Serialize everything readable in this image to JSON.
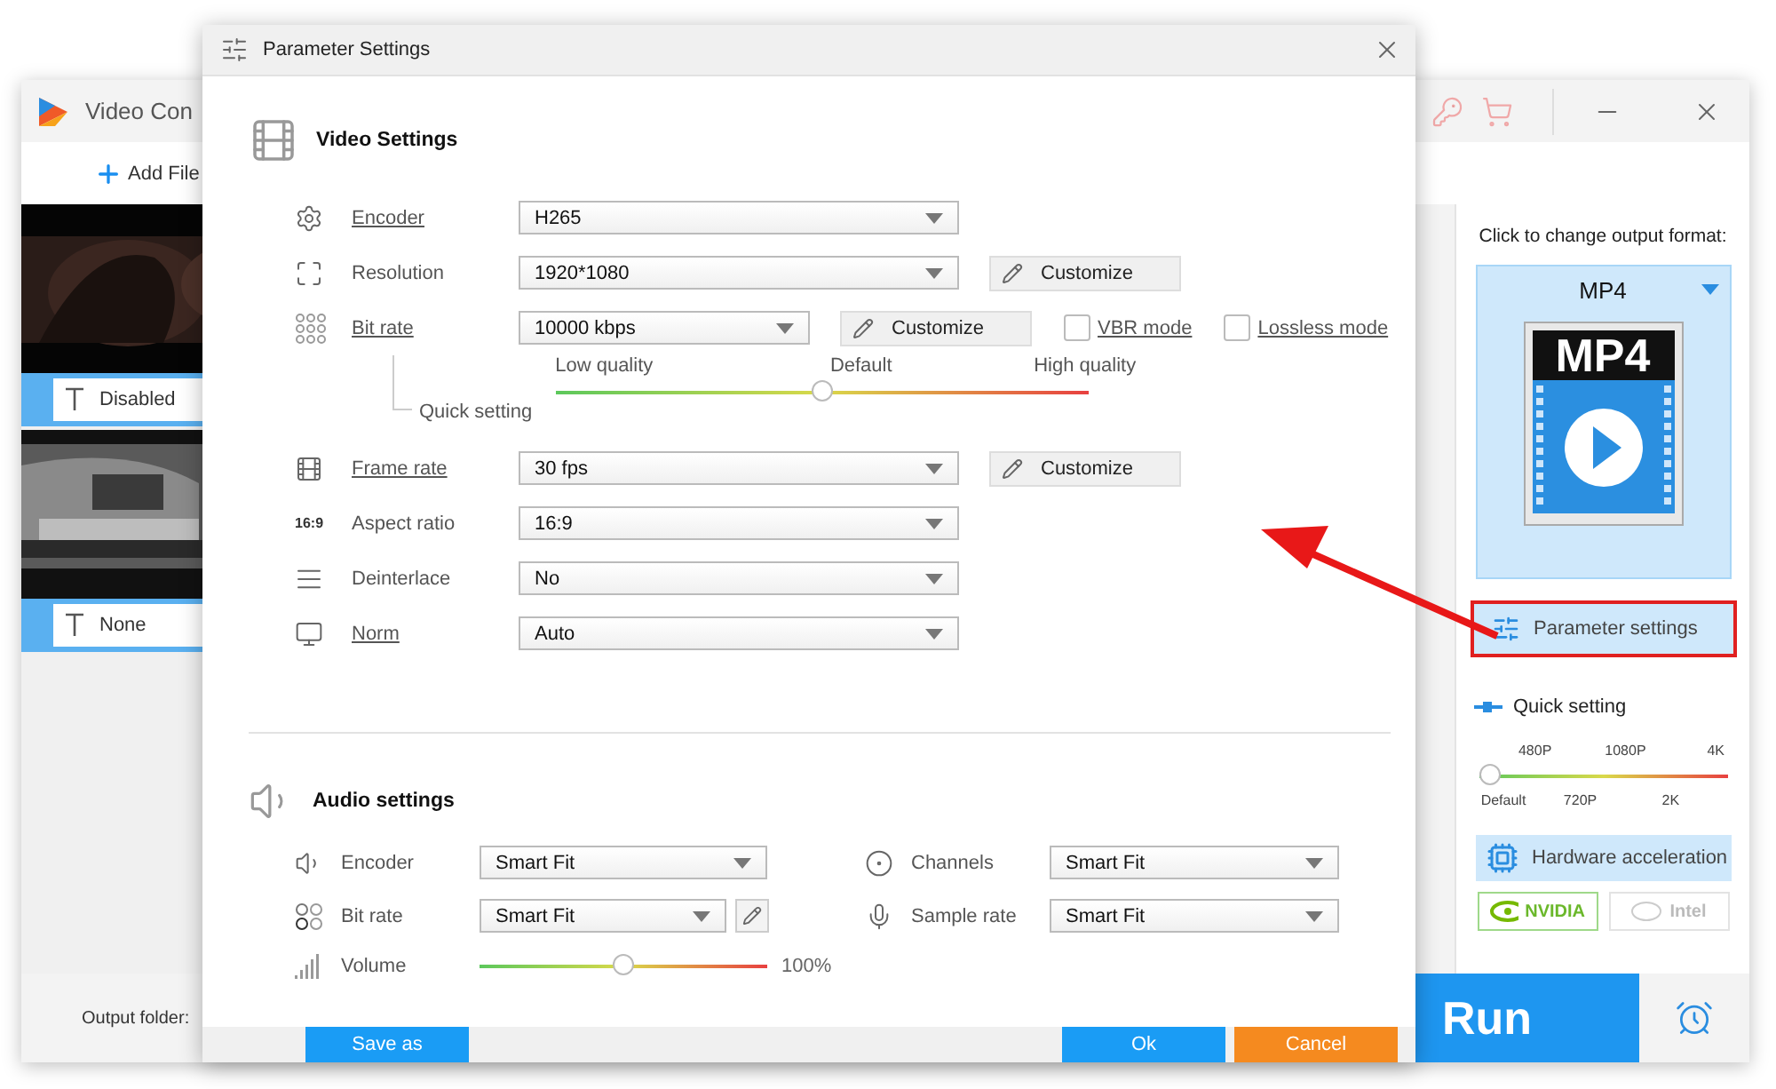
{
  "app": {
    "title": "Video Con",
    "add_file": "Add File",
    "files": [
      {
        "subtitle": "Disabled"
      },
      {
        "subtitle": "None"
      }
    ],
    "output_folder_label": "Output folder:",
    "run": "Run"
  },
  "format_panel": {
    "prompt": "Click to change output format:",
    "format": "MP4",
    "icon_label": "MP4",
    "parameter_button": "Parameter settings",
    "quick_setting": {
      "title": "Quick setting",
      "level": 0,
      "top_labels": [
        "480P",
        "1080P",
        "4K"
      ],
      "bottom_labels": [
        "Default",
        "720P",
        "2K"
      ]
    },
    "hardware": {
      "title": "Hardware acceleration",
      "options": [
        {
          "label": "NVIDIA",
          "enabled": true
        },
        {
          "label": "Intel",
          "enabled": false
        }
      ]
    }
  },
  "dialog": {
    "title": "Parameter Settings",
    "video": {
      "heading": "Video Settings",
      "rows": [
        {
          "kind": "select",
          "label": "Encoder",
          "link": true,
          "value": "H265"
        },
        {
          "kind": "select",
          "label": "Resolution",
          "link": false,
          "value": "1920*1080",
          "button": "Customize"
        },
        {
          "kind": "bitrate",
          "label": "Bit rate",
          "link": true,
          "value": "10000 kbps",
          "button": "Customize",
          "checkboxes": [
            {
              "label": "VBR mode",
              "checked": false
            },
            {
              "label": "Lossless mode",
              "checked": false
            }
          ],
          "quick": {
            "label": "Quick setting",
            "low": "Low quality",
            "mid": "Default",
            "high": "High quality",
            "level": 0.5
          }
        },
        {
          "kind": "select",
          "label": "Frame rate",
          "link": true,
          "value": "30 fps",
          "button": "Customize"
        },
        {
          "kind": "select",
          "label": "Aspect ratio",
          "link": false,
          "value": "16:9",
          "icon_text": "16:9"
        },
        {
          "kind": "select",
          "label": "Deinterlace",
          "link": false,
          "value": "No"
        },
        {
          "kind": "select",
          "label": "Norm",
          "link": true,
          "value": "Auto"
        }
      ]
    },
    "audio": {
      "heading": "Audio settings",
      "rows": [
        {
          "label": "Encoder",
          "value": "Smart Fit",
          "edit": false
        },
        {
          "label": "Channels",
          "value": "Smart Fit",
          "edit": false
        },
        {
          "label": "Bit rate",
          "value": "Smart Fit",
          "edit": true
        },
        {
          "label": "Sample rate",
          "value": "Smart Fit",
          "edit": false
        }
      ],
      "volume": {
        "label": "Volume",
        "level": 0.5,
        "reading": "100%"
      }
    },
    "buttons": [
      {
        "kind": "save",
        "label": "Save as"
      },
      {
        "kind": "ok",
        "label": "Ok"
      },
      {
        "kind": "cancel",
        "label": "Cancel"
      }
    ]
  }
}
